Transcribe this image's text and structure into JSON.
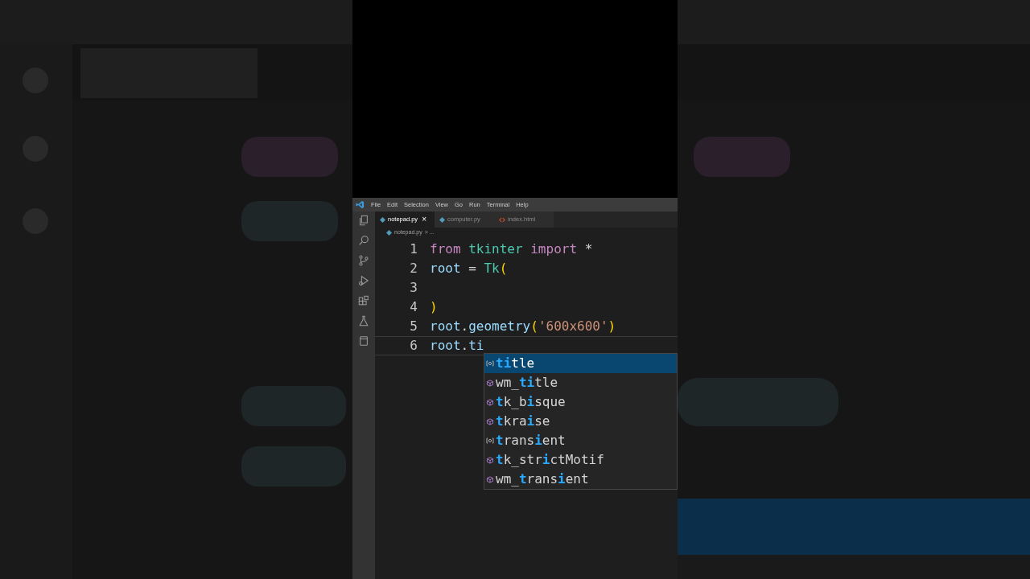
{
  "menu": [
    "File",
    "Edit",
    "Selection",
    "View",
    "Go",
    "Run",
    "Terminal",
    "Help"
  ],
  "tabs": [
    {
      "label": "notepad.py",
      "kind": "python",
      "selected": true
    },
    {
      "label": "computer.py",
      "kind": "python",
      "selected": false
    },
    {
      "label": "index.html",
      "kind": "html",
      "selected": false
    }
  ],
  "close_glyph": "×",
  "breadcrumb": {
    "file": "notepad.py",
    "rest": "> ..."
  },
  "editor": {
    "lines": [
      {
        "number": "1",
        "tokens": [
          {
            "text": "from ",
            "kind": "keyword"
          },
          {
            "text": "tkinter ",
            "kind": "type"
          },
          {
            "text": "import",
            "kind": "keyword"
          },
          {
            "text": " *",
            "kind": "plain"
          }
        ]
      },
      {
        "number": "2",
        "tokens": [
          {
            "text": "root",
            "kind": "variable"
          },
          {
            "text": " = ",
            "kind": "plain"
          },
          {
            "text": "Tk",
            "kind": "type"
          },
          {
            "text": "(",
            "kind": "bracket"
          }
        ]
      },
      {
        "number": "3"
      },
      {
        "number": "4",
        "tokens": [
          {
            "text": ")",
            "kind": "bracket"
          }
        ]
      },
      {
        "number": "5",
        "tokens": [
          {
            "text": "root",
            "kind": "variable"
          },
          {
            "text": ".",
            "kind": "plain"
          },
          {
            "text": "geometry",
            "kind": "variable"
          },
          {
            "text": "(",
            "kind": "bracket"
          },
          {
            "text": "'600x600'",
            "kind": "string"
          },
          {
            "text": ")",
            "kind": "bracket"
          }
        ]
      },
      {
        "number": "6",
        "tokens": [
          {
            "text": "root",
            "kind": "variable"
          },
          {
            "text": ".",
            "kind": "plain"
          },
          {
            "text": "ti",
            "kind": "variable"
          }
        ]
      }
    ]
  },
  "suggestions": [
    {
      "kind": "field",
      "selected": true,
      "segments": [
        {
          "text": "ti",
          "match": true
        },
        {
          "text": "tle",
          "match": false
        }
      ]
    },
    {
      "kind": "method",
      "selected": false,
      "segments": [
        {
          "text": "wm_",
          "match": false
        },
        {
          "text": "ti",
          "match": true
        },
        {
          "text": "tle",
          "match": false
        }
      ]
    },
    {
      "kind": "method",
      "selected": false,
      "segments": [
        {
          "text": "t",
          "match": true
        },
        {
          "text": "k_b",
          "match": false
        },
        {
          "text": "i",
          "match": true
        },
        {
          "text": "sque",
          "match": false
        }
      ]
    },
    {
      "kind": "method",
      "selected": false,
      "segments": [
        {
          "text": "t",
          "match": true
        },
        {
          "text": "kra",
          "match": false
        },
        {
          "text": "i",
          "match": true
        },
        {
          "text": "se",
          "match": false
        }
      ]
    },
    {
      "kind": "field",
      "selected": false,
      "segments": [
        {
          "text": "t",
          "match": true
        },
        {
          "text": "rans",
          "match": false
        },
        {
          "text": "i",
          "match": true
        },
        {
          "text": "ent",
          "match": false
        }
      ]
    },
    {
      "kind": "method",
      "selected": false,
      "segments": [
        {
          "text": "t",
          "match": true
        },
        {
          "text": "k_str",
          "match": false
        },
        {
          "text": "i",
          "match": true
        },
        {
          "text": "ctMotif",
          "match": false
        }
      ]
    },
    {
      "kind": "method",
      "selected": false,
      "segments": [
        {
          "text": "wm_",
          "match": false
        },
        {
          "text": "t",
          "match": true
        },
        {
          "text": "rans",
          "match": false
        },
        {
          "text": "i",
          "match": true
        },
        {
          "text": "ent",
          "match": false
        }
      ]
    }
  ]
}
